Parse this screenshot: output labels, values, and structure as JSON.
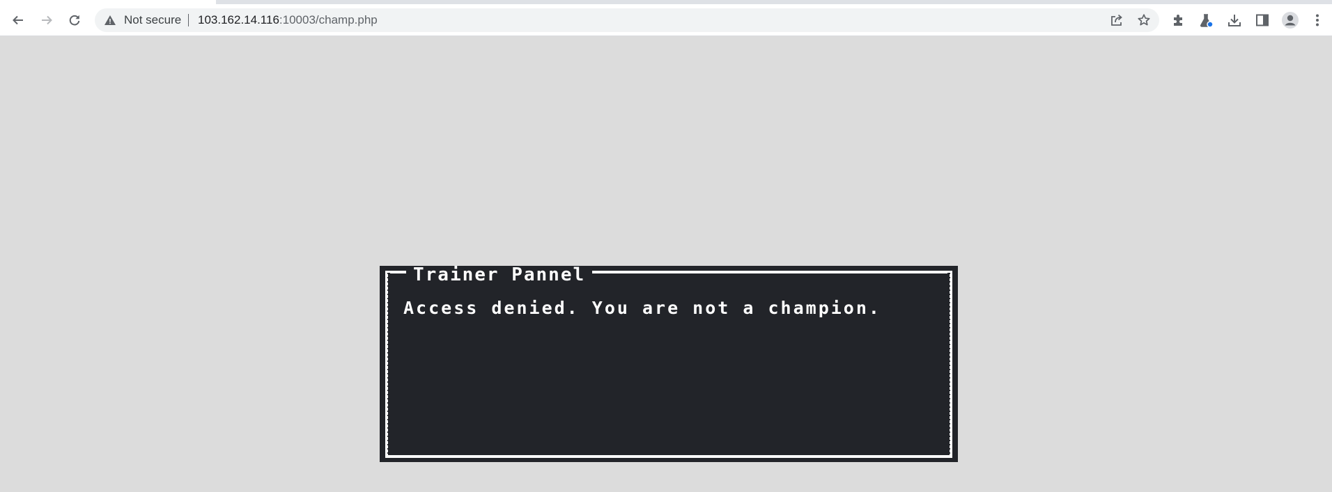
{
  "browser": {
    "security_label": "Not secure",
    "url_host": "103.162.14.116",
    "url_rest": ":10003/champ.php",
    "icons": [
      "back-icon",
      "forward-icon",
      "reload-icon",
      "warning-icon",
      "share-icon",
      "star-icon",
      "extensions-icon",
      "labs-icon",
      "download-icon",
      "side-panel-icon",
      "profile-icon",
      "menu-icon"
    ]
  },
  "panel": {
    "title": "Trainer Pannel",
    "message": "Access denied. You are not a champion."
  },
  "colors": {
    "page_background": "#dcdcdc",
    "panel_background": "#222429",
    "panel_text": "#ffffff",
    "labs_badge": "#1a73e8"
  }
}
